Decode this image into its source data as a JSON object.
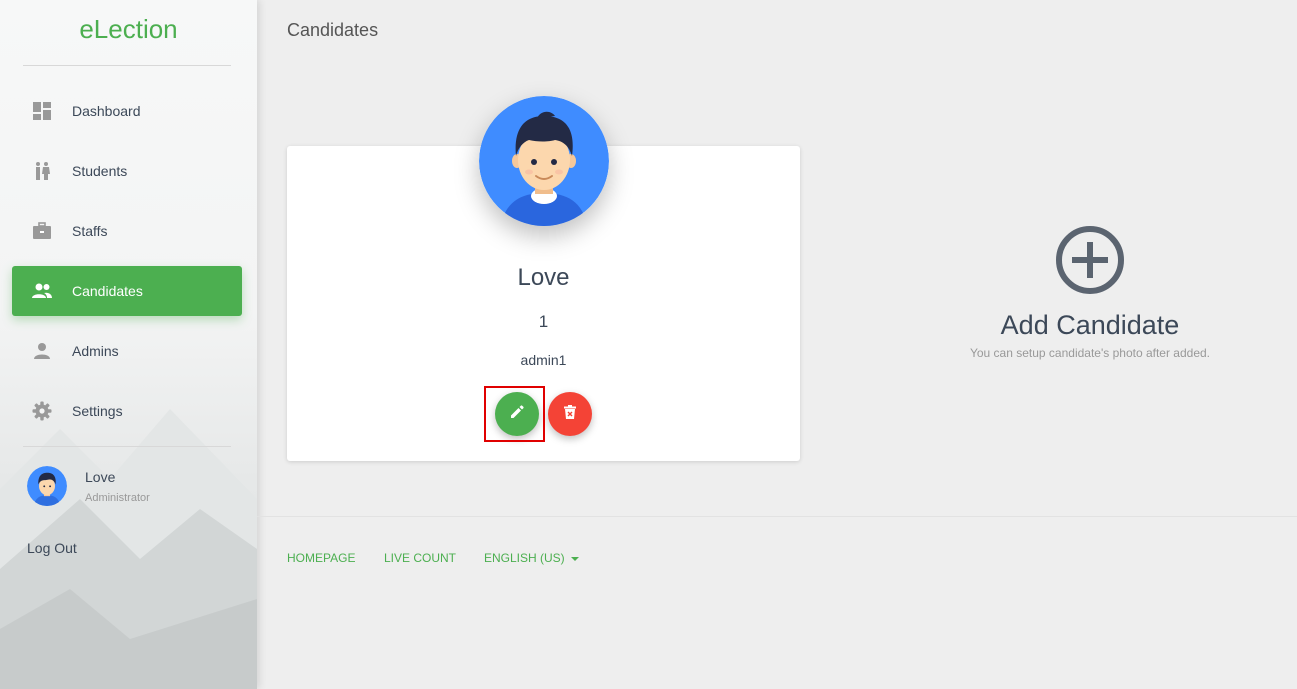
{
  "app": {
    "brand": "eLection"
  },
  "sidebar": {
    "items": [
      {
        "label": "Dashboard",
        "icon": "dashboard-icon"
      },
      {
        "label": "Students",
        "icon": "students-icon"
      },
      {
        "label": "Staffs",
        "icon": "briefcase-icon"
      },
      {
        "label": "Candidates",
        "icon": "people-icon",
        "active": true
      },
      {
        "label": "Admins",
        "icon": "person-icon"
      },
      {
        "label": "Settings",
        "icon": "gear-icon"
      }
    ],
    "user": {
      "name": "Love",
      "role": "Administrator"
    },
    "logout_label": "Log Out"
  },
  "page": {
    "title": "Candidates"
  },
  "candidate": {
    "name": "Love",
    "number": "1",
    "party": "admin1"
  },
  "add_candidate": {
    "title": "Add Candidate",
    "subtitle": "You can setup candidate's photo after added."
  },
  "footer": {
    "links": [
      "Homepage",
      "Live Count",
      "English (US)"
    ]
  },
  "colors": {
    "accent": "#4caf50",
    "danger": "#f44336",
    "avatar_bg": "#3f8cff"
  }
}
